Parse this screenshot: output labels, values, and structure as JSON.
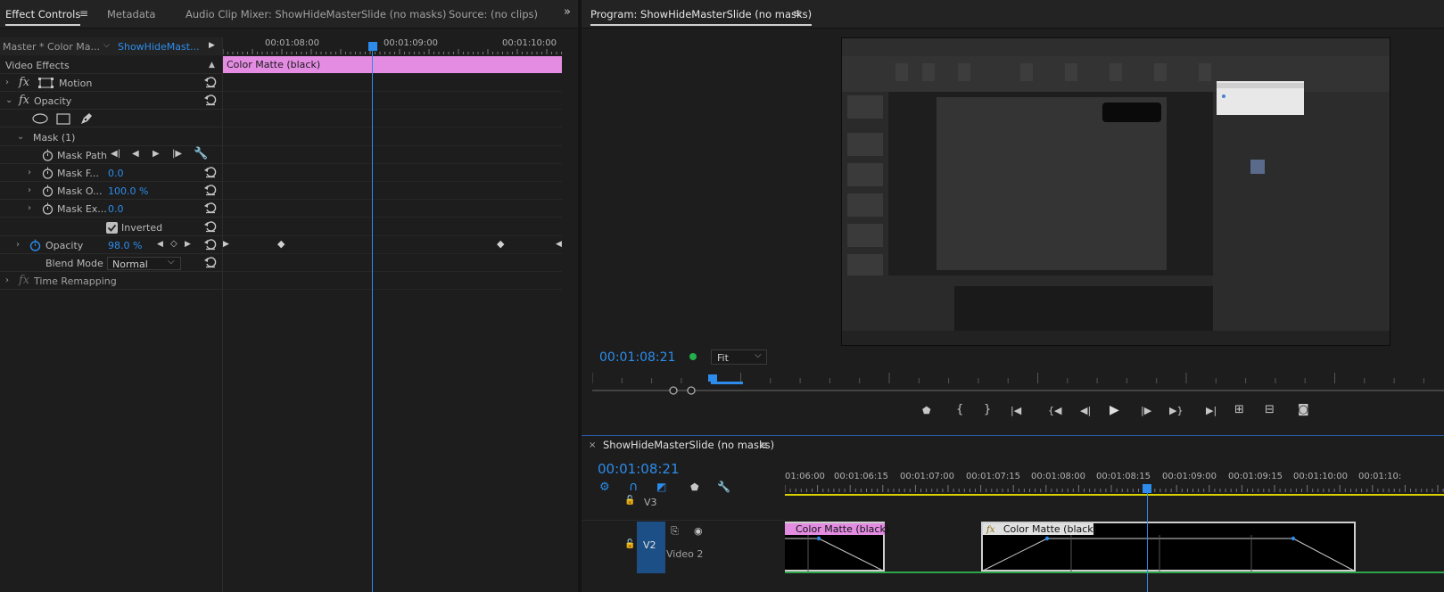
{
  "effect_controls": {
    "tabs": [
      "Effect Controls",
      "Metadata",
      "Audio Clip Mixer: ShowHideMasterSlide (no masks)",
      "Source: (no clips)"
    ],
    "master_label": "Master * Color Ma...",
    "clip_label": "ShowHideMast...",
    "section_label": "Video Effects",
    "ruler_times": [
      "00:01:08:00",
      "00:01:09:00",
      "00:01:10:00"
    ],
    "clip_bar_label": "Color Matte (black)",
    "motion": "Motion",
    "opacity": "Opacity",
    "mask": "Mask (1)",
    "mask_path": "Mask Path",
    "mask_feather": {
      "label": "Mask F...",
      "value": "0.0"
    },
    "mask_opacity": {
      "label": "Mask O...",
      "value": "100.0 %"
    },
    "mask_expansion": {
      "label": "Mask Ex...",
      "value": "0.0"
    },
    "inverted": "Inverted",
    "opacity_value": {
      "label": "Opacity",
      "value": "98.0 %"
    },
    "blend_mode": {
      "label": "Blend Mode",
      "value": "Normal"
    },
    "time_remapping": "Time Remapping"
  },
  "program": {
    "title": "Program: ShowHideMasterSlide (no masks)",
    "timecode": "00:01:08:21",
    "fit": "Fit",
    "status_color": "#22b14c"
  },
  "timeline": {
    "title": "ShowHideMasterSlide (no masks)",
    "timecode": "00:01:08:21",
    "ruler": [
      "01:06:00",
      "00:01:06:15",
      "00:01:07:00",
      "00:01:07:15",
      "00:01:08:00",
      "00:01:08:15",
      "00:01:09:00",
      "00:01:09:15",
      "00:01:10:00",
      "00:01:10:"
    ],
    "tracks": {
      "v3": "V3",
      "v2": "V2",
      "v2_name": "Video 2"
    },
    "clip1": "Color Matte (black)",
    "clip2": "Color Matte (black)",
    "clip_label_color": "#e38ce2"
  },
  "colors": {
    "accent": "#2d8ceb",
    "clip_pink": "#e38ce2"
  }
}
